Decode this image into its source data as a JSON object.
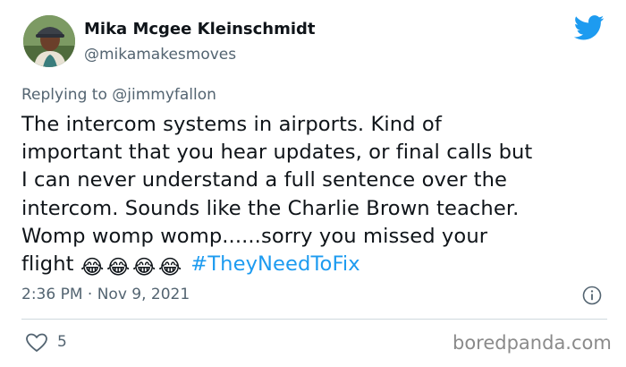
{
  "author": {
    "name": "Mika Mcgee Kleinschmidt",
    "handle": "@mikamakesmoves"
  },
  "reply": {
    "prefix": "Replying to ",
    "mention": "@jimmyfallon"
  },
  "tweet": {
    "lines": [
      "The intercom systems in airports. Kind of",
      "important that you hear updates,  or final calls but",
      "I can never understand a full sentence over the",
      "intercom. Sounds like the Charlie Brown teacher.",
      "Womp womp womp......sorry you missed your"
    ],
    "last_line_text": "flight ",
    "emojis": [
      "😂",
      "😂",
      "😂",
      "😂"
    ],
    "hashtag": "#TheyNeedToFix"
  },
  "timestamp": "2:36 PM · Nov 9, 2021",
  "likes": {
    "count": "5"
  },
  "watermark": "boredpanda.com",
  "colors": {
    "text": "#0f1419",
    "secondary": "#536471",
    "twitter_blue": "#1d9bf0",
    "divider": "#cfd9de"
  },
  "icons": [
    "twitter-bird-icon",
    "info-icon",
    "heart-icon"
  ]
}
